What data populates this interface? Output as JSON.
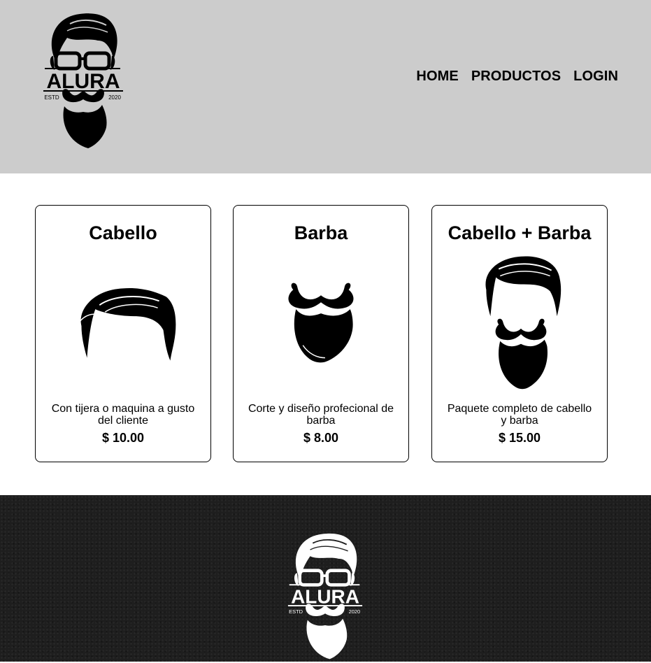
{
  "header": {
    "logo": {
      "brand": "ALURA",
      "left_text": "ESTD",
      "right_text": "2020"
    },
    "nav": [
      {
        "label": "HOME"
      },
      {
        "label": "PRODUCTOS"
      },
      {
        "label": "LOGIN"
      }
    ]
  },
  "products": [
    {
      "title": "Cabello",
      "icon": "hair-icon",
      "description": "Con tijera o maquina a gusto del cliente",
      "price": "$ 10.00"
    },
    {
      "title": "Barba",
      "icon": "beard-icon",
      "description": "Corte y diseño profecional de barba",
      "price": "$ 8.00"
    },
    {
      "title": "Cabello + Barba",
      "icon": "hair-and-beard-icon",
      "description": "Paquete completo de cabello y barba",
      "price": "$ 15.00"
    }
  ],
  "footer": {
    "logo": {
      "brand": "ALURA",
      "left_text": "ESTD",
      "right_text": "2020"
    }
  },
  "colors": {
    "header_bg": "#cccccc",
    "footer_bg": "#1e1e1e",
    "text": "#000000"
  }
}
